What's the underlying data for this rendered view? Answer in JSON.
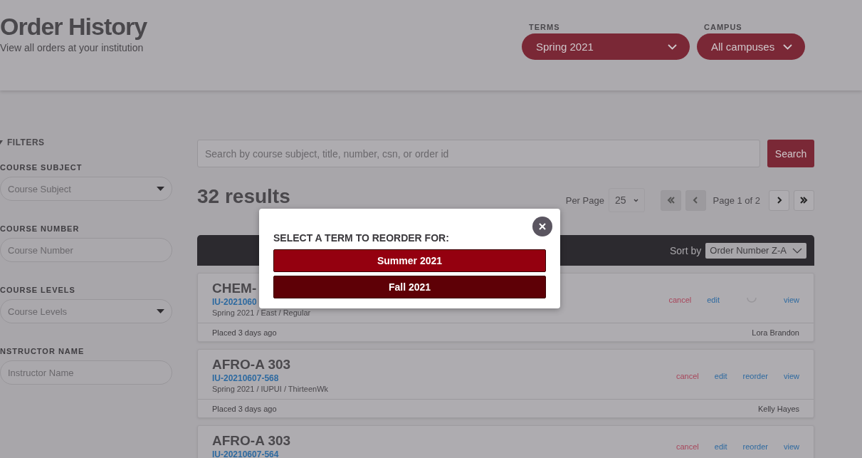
{
  "header": {
    "title": "Order History",
    "subtitle": "View all orders at your institution",
    "selects": [
      {
        "label": "TERMS",
        "value": "Spring 2021"
      },
      {
        "label": "CAMPUS",
        "value": "All campuses"
      }
    ]
  },
  "filters": {
    "title": "FILTERS",
    "expanded": true,
    "fields": [
      {
        "label": "COURSE SUBJECT",
        "placeholder": "Course Subject",
        "kind": "dropdown"
      },
      {
        "label": "COURSE NUMBER",
        "placeholder": "Course Number",
        "kind": "text"
      },
      {
        "label": "COURSE LEVELS",
        "placeholder": "Course Levels",
        "kind": "dropdown"
      },
      {
        "label": "NSTRUCTOR NAME",
        "placeholder": "Instructor Name",
        "kind": "text"
      }
    ]
  },
  "search": {
    "placeholder": "Search by course subject, title, number, csn, or order id",
    "button": "Search"
  },
  "results": {
    "count": "32 results",
    "per_page_label": "Per Page",
    "per_page": "25",
    "page_label": "Page 1 of 2",
    "pager_buttons": [
      {
        "kind": "first",
        "disabled": true
      },
      {
        "kind": "prev",
        "disabled": true
      },
      {
        "kind": "next",
        "disabled": false
      },
      {
        "kind": "last",
        "disabled": false
      }
    ],
    "sort_label": "Sort by",
    "sort_value": "Order Number Z-A"
  },
  "orders": [
    {
      "course": "CHEM-",
      "order_id": "IU-2021060",
      "details": "Spring 2021 / East / Regular",
      "placed": "Placed 3 days ago",
      "person": "Lora Brandon",
      "actions": [
        {
          "kind": "cancel",
          "label": "cancel"
        },
        {
          "kind": "link",
          "label": "edit"
        },
        {
          "kind": "spinner"
        },
        {
          "kind": "link",
          "label": "view"
        }
      ]
    },
    {
      "course": "AFRO-A 303",
      "order_id": "IU-20210607-568",
      "details": "Spring 2021 / IUPUI / ThirteenWk",
      "placed": "Placed 3 days ago",
      "person": "Kelly Hayes",
      "actions": [
        {
          "kind": "cancel",
          "label": "cancel"
        },
        {
          "kind": "link",
          "label": "edit"
        },
        {
          "kind": "link",
          "label": "reorder"
        },
        {
          "kind": "link",
          "label": "view"
        }
      ]
    },
    {
      "course": "AFRO-A 303",
      "order_id": "IU-20210607-564",
      "actions": [
        {
          "kind": "cancel",
          "label": "cancel"
        },
        {
          "kind": "link",
          "label": "edit"
        },
        {
          "kind": "link",
          "label": "reorder"
        },
        {
          "kind": "link",
          "label": "view"
        }
      ]
    }
  ],
  "modal": {
    "title": "SELECT A TERM TO REORDER FOR:",
    "terms": [
      {
        "label": "Summer 2021",
        "hovered": false
      },
      {
        "label": "Fall 2021",
        "hovered": true
      }
    ]
  }
}
